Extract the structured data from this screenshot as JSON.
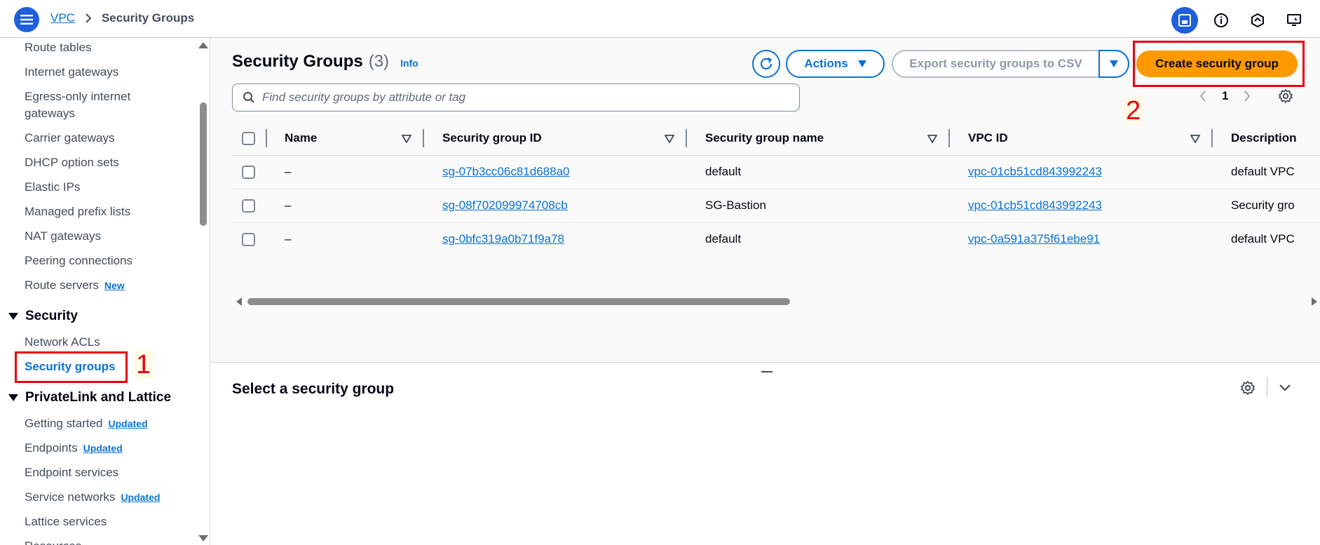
{
  "breadcrumb": {
    "parent": "VPC",
    "current": "Security Groups"
  },
  "topbar_icons": [
    "layout-panel-icon",
    "info-icon",
    "hexagon-icon",
    "remote-desktop-icon"
  ],
  "sidebar": {
    "items_top": [
      {
        "label": "Route tables"
      },
      {
        "label": "Internet gateways"
      },
      {
        "label": "Egress-only internet"
      },
      {
        "label": "gateways"
      },
      {
        "label": "Carrier gateways"
      },
      {
        "label": "DHCP option sets"
      },
      {
        "label": "Elastic IPs"
      },
      {
        "label": "Managed prefix lists"
      },
      {
        "label": "NAT gateways"
      },
      {
        "label": "Peering connections"
      },
      {
        "label": "Route servers",
        "badge": "New"
      }
    ],
    "security_section": "Security",
    "security_items": [
      {
        "label": "Network ACLs"
      },
      {
        "label": "Security groups"
      }
    ],
    "privatelink_section": "PrivateLink and Lattice",
    "privatelink_items": [
      {
        "label": "Getting started",
        "badge": "Updated"
      },
      {
        "label": "Endpoints",
        "badge": "Updated"
      },
      {
        "label": "Endpoint services"
      },
      {
        "label": "Service networks",
        "badge": "Updated"
      },
      {
        "label": "Lattice services"
      },
      {
        "label": "Resources"
      }
    ]
  },
  "header": {
    "title": "Security Groups",
    "count": "(3)",
    "info": "Info",
    "actions_label": "Actions",
    "export_label": "Export security groups to CSV",
    "create_label": "Create security group"
  },
  "search": {
    "placeholder": "Find security groups by attribute or tag"
  },
  "pagination": {
    "current_page": "1"
  },
  "table": {
    "columns": [
      "Name",
      "Security group ID",
      "Security group name",
      "VPC ID",
      "Description"
    ],
    "rows": [
      {
        "name": "–",
        "sg_id": "sg-07b3cc06c81d688a0",
        "sg_name": "default",
        "vpc_id": "vpc-01cb51cd843992243",
        "description": "default VPC"
      },
      {
        "name": "–",
        "sg_id": "sg-08f702099974708cb",
        "sg_name": "SG-Bastion",
        "vpc_id": "vpc-01cb51cd843992243",
        "description": "Security gro"
      },
      {
        "name": "–",
        "sg_id": "sg-0bfc319a0b71f9a78",
        "sg_name": "default",
        "vpc_id": "vpc-0a591a375f61ebe91",
        "description": "default VPC"
      }
    ]
  },
  "split_panel": {
    "title": "Select a security group"
  },
  "annotations": {
    "step1": "1",
    "step2": "2"
  },
  "colors": {
    "primary_blue": "#0972d3",
    "create_orange": "#ff9900",
    "annotation_red": "#e8000b"
  }
}
